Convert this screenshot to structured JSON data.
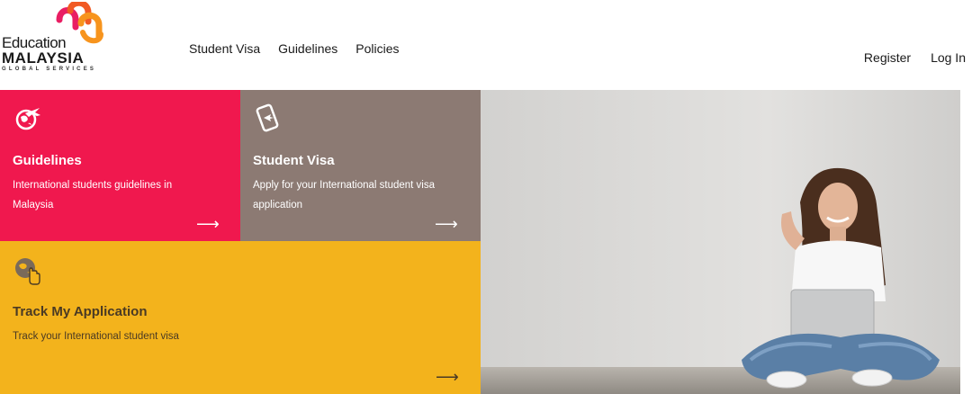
{
  "logo": {
    "line1": "Education",
    "line2": "MALAYSIA",
    "line3": "GLOBAL SERVICES"
  },
  "nav": [
    {
      "label": "Student Visa"
    },
    {
      "label": "Guidelines"
    },
    {
      "label": "Policies"
    }
  ],
  "auth": {
    "register": "Register",
    "login": "Log In"
  },
  "tiles": {
    "guidelines": {
      "title": "Guidelines",
      "desc": "International students guidelines in Malaysia",
      "arrow": "⟶",
      "icon": "globe-plane-icon",
      "color": "#f0184e"
    },
    "visa": {
      "title": "Student Visa",
      "desc": "Apply for your International student visa application",
      "arrow": "⟶",
      "icon": "mobile-plane-icon",
      "color": "#8c7a73"
    },
    "track": {
      "title": "Track My Application",
      "desc": "Track your International student visa",
      "arrow": "⟶",
      "icon": "globe-pointer-icon",
      "color": "#f3b31c"
    }
  },
  "hero": {
    "image": "student-with-laptop-photo"
  }
}
